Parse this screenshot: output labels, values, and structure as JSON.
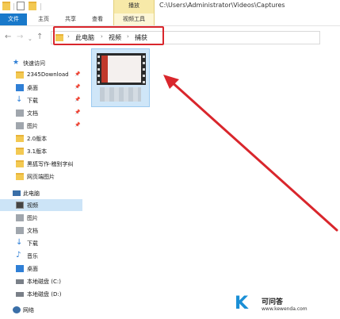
{
  "window": {
    "context_tab_label": "播放",
    "path": "C:\\Users\\Administrator\\Videos\\Captures"
  },
  "ribbon": {
    "tabs": [
      "文件",
      "主页",
      "共享",
      "查看",
      "视频工具"
    ]
  },
  "address": {
    "crumbs": [
      "此电脑",
      "视频",
      "捕获"
    ]
  },
  "sidebar": {
    "quick_access": "快速访问",
    "quick_items": [
      {
        "label": "2345Download",
        "icon": "folder-icon",
        "pinned": true
      },
      {
        "label": "桌面",
        "icon": "desktop-icon",
        "pinned": true
      },
      {
        "label": "下载",
        "icon": "download-icon",
        "pinned": true
      },
      {
        "label": "文档",
        "icon": "document-icon",
        "pinned": true
      },
      {
        "label": "图片",
        "icon": "picture-icon",
        "pinned": true
      },
      {
        "label": "2.0版本",
        "icon": "folder-icon",
        "pinned": false
      },
      {
        "label": "3.1版本",
        "icon": "folder-icon",
        "pinned": false
      },
      {
        "label": "黑狐写作-稽别字纠",
        "icon": "folder-icon",
        "pinned": false
      },
      {
        "label": "网页端图片",
        "icon": "folder-icon",
        "pinned": false
      }
    ],
    "this_pc": "此电脑",
    "pc_items": [
      {
        "label": "视频",
        "icon": "video-icon",
        "selected": true
      },
      {
        "label": "图片",
        "icon": "picture-icon",
        "selected": false
      },
      {
        "label": "文档",
        "icon": "document-icon",
        "selected": false
      },
      {
        "label": "下载",
        "icon": "download-icon",
        "selected": false
      },
      {
        "label": "音乐",
        "icon": "music-icon",
        "selected": false
      },
      {
        "label": "桌面",
        "icon": "desktop-icon",
        "selected": false
      },
      {
        "label": "本地磁盘 (C:)",
        "icon": "drive-icon",
        "selected": false
      },
      {
        "label": "本地磁盘 (D:)",
        "icon": "drive-icon",
        "selected": false
      }
    ],
    "network": "网络"
  },
  "watermark": {
    "logo": "K",
    "name": "可问答",
    "url": "www.kewenda.com"
  },
  "colors": {
    "accent": "#1979ca",
    "annotation": "#d9262c",
    "context_tab": "#f7e9a8"
  }
}
